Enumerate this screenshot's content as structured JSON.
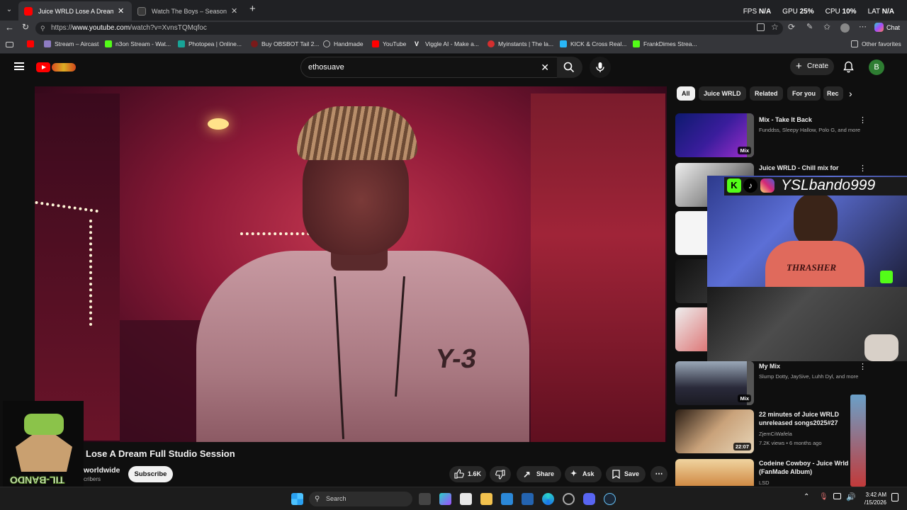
{
  "browser": {
    "tabs": [
      {
        "title": "Juice WRLD Lose A Dream Fu",
        "active": true
      },
      {
        "title": "Watch The Boys – Season 2 | Prim",
        "active": false
      }
    ],
    "perf": {
      "fps_label": "FPS",
      "fps_value": "N/A",
      "gpu_label": "GPU",
      "gpu_value": "25%",
      "cpu_label": "CPU",
      "cpu_value": "10%",
      "lat_label": "LAT",
      "lat_value": "N/A"
    },
    "url_prefix": "https://",
    "url_host": "www.youtube.com",
    "url_path": "/watch?v=XvnsTQMqfoc",
    "chat_label": "Chat",
    "bookmarks": [
      {
        "label": "Stream – Aircast",
        "color": "#8e7cc3"
      },
      {
        "label": "n3on Stream - Wat...",
        "color": "#53fc18"
      },
      {
        "label": "Photopea | Online...",
        "color": "#18a497"
      },
      {
        "label": "Buy OBSBOT Tail 2...",
        "color": "#c0392b"
      },
      {
        "label": "Handmade",
        "color": "#bbbbbb"
      },
      {
        "label": "YouTube",
        "color": "#ff0000"
      },
      {
        "label": "Viggle AI - Make a...",
        "color": "#ffffff"
      },
      {
        "label": "Myinstants | The la...",
        "color": "#d32f2f"
      },
      {
        "label": "KICK & Cross Real...",
        "color": "#29b6f6"
      },
      {
        "label": "FrankDimes Strea...",
        "color": "#53fc18"
      }
    ],
    "other_favorites": "Other favorites"
  },
  "youtube": {
    "search_value": "ethosuave",
    "create_label": "Create",
    "avatar_letter": "B",
    "chips": [
      "All",
      "Juice WRLD",
      "Related",
      "For you",
      "Rec"
    ],
    "video": {
      "title": "D Lose A Dream Full Studio Session",
      "channel": "worldwide",
      "subscribers": "cribers",
      "subscribe_label": "Subscribe",
      "likes": "1.6K",
      "share_label": "Share",
      "ask_label": "Ask",
      "save_label": "Save",
      "shirt_text": "Y-3"
    },
    "recommendations": [
      {
        "title": "Mix - Take It Back",
        "meta1": "Funddss, Sleepy Hallow, Polo G, and more",
        "meta2": "",
        "badge": "Mix"
      },
      {
        "title": "Juice WRLD - Chill mix for",
        "meta1": "",
        "meta2": "",
        "badge": ""
      },
      {
        "title": "My Mix",
        "meta1": "Slump Dotty, JaySive, Luhh Dyl, and more",
        "meta2": "",
        "badge": "Mix"
      },
      {
        "title": "22 minutes of Juice WRLD unreleased songs2025#27",
        "meta1": "ZjemCiWafela",
        "meta2": "7.2K views • 6 months ago",
        "badge": "22:07"
      },
      {
        "title": "Codeine Cowboy - Juice Wrld (FanMade Album)",
        "meta1": "LSD",
        "meta2": "",
        "badge": ""
      }
    ]
  },
  "overlay": {
    "streamer_name": "YSLbando999",
    "shirt_brand": "THRASHER",
    "logo_text": "TIL-BANDO"
  },
  "taskbar": {
    "search_placeholder": "Search",
    "time": "3:42 AM",
    "date": "/15/2026"
  },
  "colors": {
    "yt_red": "#ff0000",
    "kick_green": "#53fc18",
    "bg": "#0f0f0f"
  }
}
